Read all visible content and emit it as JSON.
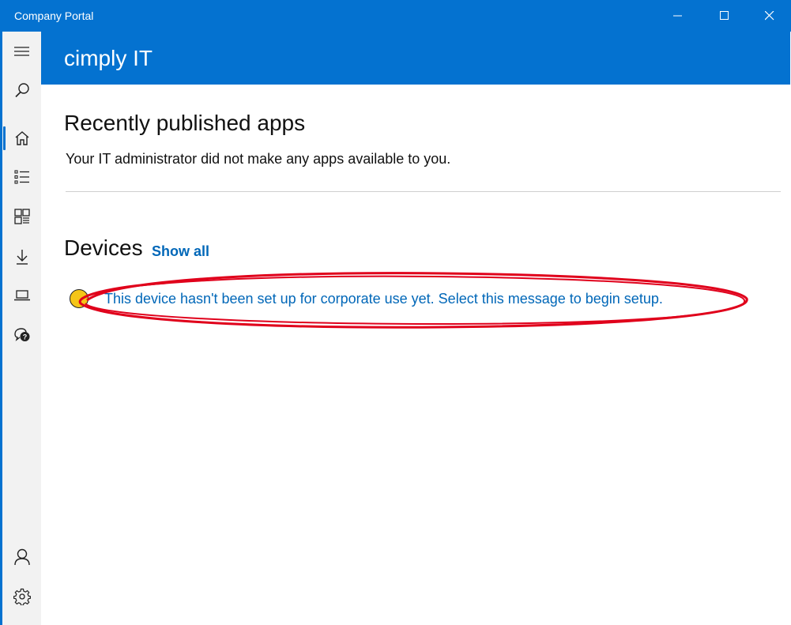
{
  "window": {
    "title": "Company Portal",
    "controls": {
      "minimize": "minimize",
      "maximize": "maximize",
      "close": "close"
    }
  },
  "header": {
    "org_name": "cimply IT"
  },
  "nav": {
    "items": [
      {
        "name": "menu",
        "icon": "hamburger-icon"
      },
      {
        "name": "search",
        "icon": "search-icon"
      },
      {
        "name": "home",
        "icon": "home-icon",
        "active": true
      },
      {
        "name": "apps",
        "icon": "list-icon"
      },
      {
        "name": "categories",
        "icon": "category-icon"
      },
      {
        "name": "downloads",
        "icon": "download-icon"
      },
      {
        "name": "devices",
        "icon": "laptop-icon"
      },
      {
        "name": "help",
        "icon": "help-chat-icon"
      },
      {
        "name": "account",
        "icon": "person-icon"
      },
      {
        "name": "settings",
        "icon": "gear-icon"
      }
    ]
  },
  "recent_apps": {
    "title": "Recently published apps",
    "message": "Your IT administrator did not make any apps available to you."
  },
  "devices": {
    "title": "Devices",
    "show_all": "Show all",
    "setup_message": "This device hasn't been set up for corporate use yet. Select this message to begin setup."
  },
  "colors": {
    "accent": "#0472d0",
    "link": "#0067b8",
    "warning": "#f5c518",
    "annotation": "#e0001b"
  }
}
